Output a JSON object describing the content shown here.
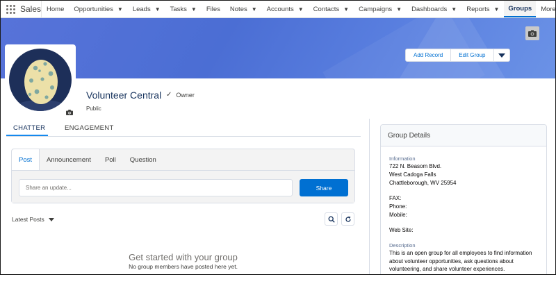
{
  "nav": {
    "app_name": "Sales",
    "tabs": [
      {
        "label": "Home",
        "has_menu": false
      },
      {
        "label": "Opportunities",
        "has_menu": true
      },
      {
        "label": "Leads",
        "has_menu": true
      },
      {
        "label": "Tasks",
        "has_menu": true
      },
      {
        "label": "Files",
        "has_menu": false
      },
      {
        "label": "Notes",
        "has_menu": true
      },
      {
        "label": "Accounts",
        "has_menu": true
      },
      {
        "label": "Contacts",
        "has_menu": true
      },
      {
        "label": "Campaigns",
        "has_menu": true
      },
      {
        "label": "Dashboards",
        "has_menu": true
      },
      {
        "label": "Reports",
        "has_menu": true
      }
    ],
    "active_tab": "Groups",
    "more_label": "More"
  },
  "header": {
    "add_record_label": "Add Record",
    "edit_group_label": "Edit Group",
    "group_name": "Volunteer Central",
    "role": "Owner",
    "visibility": "Public"
  },
  "feed_tabs": {
    "chatter": "CHATTER",
    "engagement": "ENGAGEMENT"
  },
  "publisher": {
    "tabs": [
      "Post",
      "Announcement",
      "Poll",
      "Question"
    ],
    "active_tab": "Post",
    "placeholder": "Share an update...",
    "share_label": "Share"
  },
  "feed": {
    "sort_label": "Latest Posts",
    "empty_title": "Get started with your group",
    "empty_subtitle": "No group members have posted here yet."
  },
  "details": {
    "title": "Group Details",
    "information_label": "Information",
    "address_line1": "722 N. Beasom Blvd.",
    "address_line2": "West Cadoga Falls",
    "address_line3": "Chattleborough, WV 25954",
    "fax_label": "FAX:",
    "phone_label": "Phone:",
    "mobile_label": "Mobile:",
    "website_label": "Web Site:",
    "description_label": "Description",
    "description": "This is an open group for all employees to find information about volunteer opportunities, ask questions about volunteering, and share volunteer experiences."
  },
  "colors": {
    "brand": "#0070d2",
    "banner": "#5773d9",
    "avatar_bg": "#1d2f59"
  }
}
